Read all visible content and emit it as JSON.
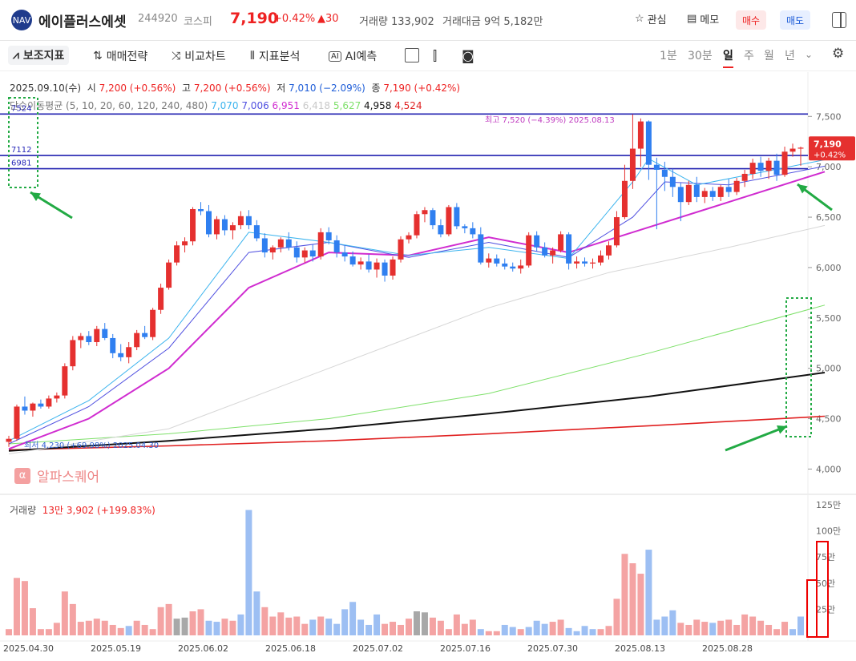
{
  "header": {
    "logo_text": "NAV",
    "name": "에이플러스에셋",
    "code": "244920",
    "market": "코스피",
    "price": "7,190",
    "change_pct": "+0.42%",
    "change_abs": "▲30",
    "volume": "거래량 133,902",
    "amount": "거래대금 9억 5,182만",
    "watch_label": "관심",
    "memo_label": "메모",
    "buy_label": "매수",
    "sell_label": "매도"
  },
  "toolbar": {
    "indicator_label": "보조지표",
    "strategy_label": "매매전략",
    "compare_label": "비교차트",
    "analysis_label": "지표분석",
    "ai_label": "AI예측",
    "ai_badge": "AI",
    "periods": [
      "1분",
      "30분",
      "일",
      "주",
      "월",
      "년"
    ],
    "selected_period": "일"
  },
  "info": {
    "date": "2025.09.10(수)",
    "open_label": "시",
    "open": "7,200 (+0.56%)",
    "high_label": "고",
    "high": "7,200 (+0.56%)",
    "low_label": "저",
    "low": "7,010 (−2.09%)",
    "close_label": "종",
    "close": "7,190 (+0.42%)",
    "ma_label": "단순이동평균 (5, 10, 20, 60, 120, 240, 480)",
    "ma_values": [
      "7,070",
      "7,006",
      "6,951",
      "6,418",
      "5,627",
      "4,958",
      "4,524"
    ],
    "ma_colors": [
      "#3cb4ee",
      "#5050e0",
      "#d02cd0",
      "#c8c8c8",
      "#7ee06a",
      "#111111",
      "#e02020"
    ]
  },
  "chart_data": {
    "type": "candlestick",
    "y_ticks": [
      "7,500",
      "7,000",
      "6,500",
      "6,000",
      "5,500",
      "5,000",
      "4,500",
      "4,000"
    ],
    "ylim": [
      3900,
      7900
    ],
    "x_ticks": [
      "2025.04.30",
      "2025.05.19",
      "2025.06.02",
      "2025.06.18",
      "2025.07.02",
      "2025.07.16",
      "2025.07.30",
      "2025.08.13",
      "2025.08.28"
    ],
    "hlines": [
      {
        "label": "7524",
        "value": 7524
      },
      {
        "label": "7112",
        "value": 7112
      },
      {
        "label": "6981",
        "value": 6981
      }
    ],
    "max_label": "최고 7,520 (−4.39%)  2025.08.13",
    "min_label": "최저 4,230 (+69.98%)  2025.04.30",
    "last_price": "7,190",
    "last_change": "+0.42%",
    "volume_label": "거래량",
    "volume_value": "13만 3,902 (+199.83%)",
    "volume_ticks": [
      "125만",
      "100만",
      "75만",
      "50만",
      "25만"
    ],
    "volume_max": 1250000,
    "candles": [
      [
        4270,
        4330,
        4220,
        4300
      ],
      [
        4300,
        4640,
        4280,
        4620
      ],
      [
        4620,
        4720,
        4540,
        4580
      ],
      [
        4580,
        4660,
        4520,
        4650
      ],
      [
        4650,
        4690,
        4600,
        4620
      ],
      [
        4620,
        4730,
        4600,
        4700
      ],
      [
        4700,
        4760,
        4660,
        4730
      ],
      [
        4730,
        5050,
        4700,
        5020
      ],
      [
        5020,
        5320,
        4980,
        5280
      ],
      [
        5280,
        5350,
        5200,
        5320
      ],
      [
        5320,
        5370,
        5230,
        5260
      ],
      [
        5260,
        5420,
        5220,
        5390
      ],
      [
        5390,
        5450,
        5280,
        5300
      ],
      [
        5300,
        5340,
        5100,
        5150
      ],
      [
        5150,
        5240,
        5070,
        5110
      ],
      [
        5110,
        5260,
        5050,
        5210
      ],
      [
        5210,
        5380,
        5180,
        5350
      ],
      [
        5350,
        5420,
        5290,
        5310
      ],
      [
        5310,
        5600,
        5280,
        5580
      ],
      [
        5580,
        5840,
        5540,
        5800
      ],
      [
        5800,
        6080,
        5780,
        6050
      ],
      [
        6050,
        6260,
        6020,
        6220
      ],
      [
        6220,
        6300,
        6150,
        6260
      ],
      [
        6260,
        6600,
        6220,
        6580
      ],
      [
        6580,
        6650,
        6520,
        6560
      ],
      [
        6560,
        6620,
        6300,
        6330
      ],
      [
        6330,
        6510,
        6280,
        6480
      ],
      [
        6480,
        6520,
        6320,
        6370
      ],
      [
        6370,
        6450,
        6280,
        6420
      ],
      [
        6420,
        6560,
        6380,
        6510
      ],
      [
        6510,
        6570,
        6380,
        6420
      ],
      [
        6420,
        6470,
        6260,
        6290
      ],
      [
        6290,
        6340,
        6100,
        6150
      ],
      [
        6150,
        6220,
        6080,
        6200
      ],
      [
        6200,
        6300,
        6150,
        6280
      ],
      [
        6280,
        6350,
        6170,
        6200
      ],
      [
        6200,
        6260,
        6050,
        6100
      ],
      [
        6100,
        6200,
        6050,
        6170
      ],
      [
        6170,
        6230,
        6060,
        6110
      ],
      [
        6110,
        6390,
        6080,
        6350
      ],
      [
        6350,
        6400,
        6230,
        6270
      ],
      [
        6270,
        6320,
        6100,
        6150
      ],
      [
        6150,
        6220,
        6060,
        6110
      ],
      [
        6110,
        6160,
        6010,
        6030
      ],
      [
        6030,
        6100,
        5980,
        6060
      ],
      [
        6060,
        6130,
        5950,
        5980
      ],
      [
        5980,
        6090,
        5900,
        6050
      ],
      [
        6050,
        6080,
        5860,
        5920
      ],
      [
        5920,
        6110,
        5880,
        6080
      ],
      [
        6080,
        6310,
        6050,
        6280
      ],
      [
        6280,
        6350,
        6240,
        6320
      ],
      [
        6320,
        6560,
        6290,
        6530
      ],
      [
        6530,
        6600,
        6450,
        6570
      ],
      [
        6570,
        6590,
        6380,
        6420
      ],
      [
        6420,
        6480,
        6300,
        6330
      ],
      [
        6330,
        6620,
        6310,
        6600
      ],
      [
        6600,
        6640,
        6380,
        6410
      ],
      [
        6410,
        6430,
        6340,
        6390
      ],
      [
        6390,
        6450,
        6290,
        6330
      ],
      [
        6330,
        6400,
        6030,
        6050
      ],
      [
        6050,
        6140,
        6000,
        6090
      ],
      [
        6090,
        6130,
        6010,
        6040
      ],
      [
        6040,
        6090,
        5980,
        6010
      ],
      [
        6010,
        6050,
        5960,
        5990
      ],
      [
        5990,
        6080,
        5940,
        6020
      ],
      [
        6020,
        6350,
        6000,
        6320
      ],
      [
        6320,
        6360,
        6160,
        6200
      ],
      [
        6200,
        6250,
        6100,
        6120
      ],
      [
        6120,
        6200,
        6040,
        6170
      ],
      [
        6170,
        6360,
        6150,
        6330
      ],
      [
        6330,
        6350,
        5980,
        6040
      ],
      [
        6040,
        6110,
        5990,
        6060
      ],
      [
        6060,
        6100,
        6010,
        6040
      ],
      [
        6040,
        6090,
        5990,
        6050
      ],
      [
        6050,
        6170,
        6020,
        6120
      ],
      [
        6120,
        6260,
        6080,
        6220
      ],
      [
        6220,
        6560,
        6200,
        6500
      ],
      [
        6500,
        7020,
        6480,
        6860
      ],
      [
        6860,
        7520,
        6780,
        7180
      ],
      [
        7180,
        7480,
        7000,
        7450
      ],
      [
        7450,
        7460,
        6870,
        7020
      ],
      [
        7020,
        7090,
        6380,
        6970
      ],
      [
        6970,
        7050,
        6760,
        6900
      ],
      [
        6900,
        6980,
        6700,
        6800
      ],
      [
        6800,
        6840,
        6460,
        6650
      ],
      [
        6650,
        6860,
        6620,
        6820
      ],
      [
        6820,
        6900,
        6650,
        6700
      ],
      [
        6700,
        6790,
        6640,
        6760
      ],
      [
        6760,
        6800,
        6660,
        6700
      ],
      [
        6700,
        6820,
        6660,
        6800
      ],
      [
        6800,
        6880,
        6700,
        6750
      ],
      [
        6750,
        6890,
        6720,
        6860
      ],
      [
        6860,
        6970,
        6800,
        6930
      ],
      [
        6930,
        7080,
        6880,
        7040
      ],
      [
        7040,
        7100,
        6900,
        6960
      ],
      [
        6960,
        7090,
        6880,
        7060
      ],
      [
        7060,
        7130,
        6860,
        6920
      ],
      [
        6920,
        7200,
        6900,
        7150
      ],
      [
        7150,
        7230,
        7100,
        7180
      ],
      [
        7180,
        7200,
        7010,
        7190
      ]
    ],
    "volumes": [
      [
        60000,
        "up"
      ],
      [
        550000,
        "up"
      ],
      [
        520000,
        "up"
      ],
      [
        260000,
        "up"
      ],
      [
        60000,
        "up"
      ],
      [
        60000,
        "up"
      ],
      [
        120000,
        "up"
      ],
      [
        420000,
        "up"
      ],
      [
        300000,
        "up"
      ],
      [
        130000,
        "up"
      ],
      [
        140000,
        "up"
      ],
      [
        160000,
        "up"
      ],
      [
        140000,
        "up"
      ],
      [
        100000,
        "up"
      ],
      [
        70000,
        "up"
      ],
      [
        90000,
        "down"
      ],
      [
        140000,
        "up"
      ],
      [
        100000,
        "up"
      ],
      [
        60000,
        "up"
      ],
      [
        270000,
        "up"
      ],
      [
        300000,
        "up"
      ],
      [
        160000,
        "flat"
      ],
      [
        170000,
        "flat"
      ],
      [
        230000,
        "up"
      ],
      [
        250000,
        "up"
      ],
      [
        140000,
        "down"
      ],
      [
        130000,
        "down"
      ],
      [
        160000,
        "up"
      ],
      [
        140000,
        "up"
      ],
      [
        200000,
        "down"
      ],
      [
        1200000,
        "down"
      ],
      [
        420000,
        "down"
      ],
      [
        270000,
        "up"
      ],
      [
        180000,
        "up"
      ],
      [
        220000,
        "up"
      ],
      [
        170000,
        "up"
      ],
      [
        180000,
        "up"
      ],
      [
        110000,
        "up"
      ],
      [
        150000,
        "down"
      ],
      [
        180000,
        "up"
      ],
      [
        160000,
        "down"
      ],
      [
        110000,
        "down"
      ],
      [
        250000,
        "down"
      ],
      [
        320000,
        "down"
      ],
      [
        150000,
        "down"
      ],
      [
        100000,
        "down"
      ],
      [
        200000,
        "down"
      ],
      [
        110000,
        "up"
      ],
      [
        130000,
        "up"
      ],
      [
        100000,
        "up"
      ],
      [
        160000,
        "up"
      ],
      [
        230000,
        "flat"
      ],
      [
        220000,
        "flat"
      ],
      [
        170000,
        "up"
      ],
      [
        140000,
        "up"
      ],
      [
        60000,
        "up"
      ],
      [
        200000,
        "up"
      ],
      [
        110000,
        "up"
      ],
      [
        150000,
        "up"
      ],
      [
        60000,
        "down"
      ],
      [
        40000,
        "up"
      ],
      [
        40000,
        "up"
      ],
      [
        100000,
        "down"
      ],
      [
        80000,
        "down"
      ],
      [
        60000,
        "up"
      ],
      [
        80000,
        "down"
      ],
      [
        140000,
        "down"
      ],
      [
        110000,
        "down"
      ],
      [
        130000,
        "up"
      ],
      [
        150000,
        "up"
      ],
      [
        70000,
        "down"
      ],
      [
        40000,
        "down"
      ],
      [
        90000,
        "down"
      ],
      [
        60000,
        "down"
      ],
      [
        60000,
        "up"
      ],
      [
        90000,
        "up"
      ],
      [
        350000,
        "up"
      ],
      [
        780000,
        "up"
      ],
      [
        690000,
        "up"
      ],
      [
        590000,
        "up"
      ],
      [
        820000,
        "down"
      ],
      [
        150000,
        "down"
      ],
      [
        180000,
        "down"
      ],
      [
        240000,
        "down"
      ],
      [
        120000,
        "up"
      ],
      [
        100000,
        "up"
      ],
      [
        150000,
        "up"
      ],
      [
        130000,
        "up"
      ],
      [
        120000,
        "down"
      ],
      [
        140000,
        "up"
      ],
      [
        150000,
        "up"
      ],
      [
        100000,
        "up"
      ],
      [
        200000,
        "up"
      ],
      [
        180000,
        "up"
      ],
      [
        140000,
        "up"
      ],
      [
        100000,
        "up"
      ],
      [
        60000,
        "up"
      ],
      [
        130000,
        "up"
      ],
      [
        60000,
        "down"
      ],
      [
        180000,
        "down"
      ]
    ],
    "ma_series": {
      "ma5": [
        [
          0,
          4280
        ],
        [
          10,
          4680
        ],
        [
          20,
          5300
        ],
        [
          30,
          6350
        ],
        [
          40,
          6250
        ],
        [
          50,
          6120
        ],
        [
          60,
          6200
        ],
        [
          70,
          6090
        ],
        [
          78,
          6850
        ],
        [
          80,
          7080
        ],
        [
          86,
          6820
        ],
        [
          95,
          6960
        ],
        [
          102,
          7070
        ]
      ],
      "ma10": [
        [
          0,
          4250
        ],
        [
          10,
          4620
        ],
        [
          20,
          5200
        ],
        [
          30,
          6150
        ],
        [
          40,
          6250
        ],
        [
          50,
          6100
        ],
        [
          60,
          6250
        ],
        [
          70,
          6100
        ],
        [
          78,
          6500
        ],
        [
          82,
          6850
        ],
        [
          90,
          6820
        ],
        [
          102,
          7006
        ]
      ],
      "ma20": [
        [
          0,
          4200
        ],
        [
          10,
          4500
        ],
        [
          20,
          5000
        ],
        [
          30,
          5800
        ],
        [
          40,
          6150
        ],
        [
          50,
          6120
        ],
        [
          60,
          6300
        ],
        [
          70,
          6150
        ],
        [
          78,
          6350
        ],
        [
          88,
          6600
        ],
        [
          102,
          6951
        ]
      ],
      "ma60": [
        [
          0,
          4150
        ],
        [
          20,
          4400
        ],
        [
          40,
          5000
        ],
        [
          60,
          5600
        ],
        [
          75,
          5950
        ],
        [
          90,
          6200
        ],
        [
          102,
          6418
        ]
      ],
      "ma120": [
        [
          0,
          4250
        ],
        [
          20,
          4350
        ],
        [
          40,
          4500
        ],
        [
          60,
          4750
        ],
        [
          80,
          5150
        ],
        [
          102,
          5627
        ]
      ],
      "ma240": [
        [
          0,
          4180
        ],
        [
          20,
          4280
        ],
        [
          40,
          4400
        ],
        [
          60,
          4550
        ],
        [
          80,
          4720
        ],
        [
          102,
          4958
        ]
      ],
      "ma480": [
        [
          0,
          4190
        ],
        [
          20,
          4230
        ],
        [
          40,
          4280
        ],
        [
          60,
          4350
        ],
        [
          80,
          4430
        ],
        [
          102,
          4524
        ]
      ]
    }
  }
}
